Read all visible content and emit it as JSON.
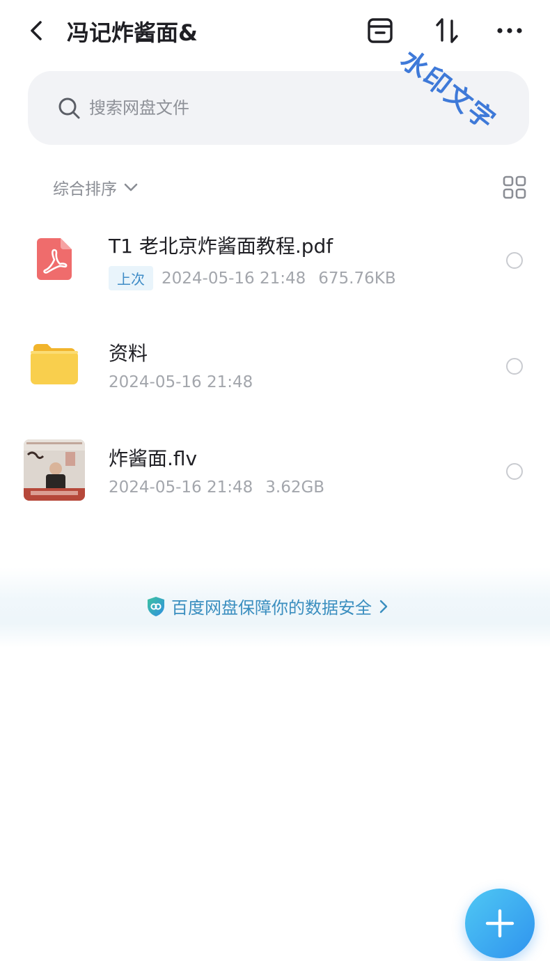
{
  "header": {
    "title": "冯记炸酱面&",
    "icons": [
      "back-icon",
      "archive-icon",
      "sort-icon",
      "more-icon"
    ]
  },
  "watermark": "水印文字",
  "search": {
    "placeholder": "搜索网盘文件"
  },
  "sort": {
    "label": "综合排序"
  },
  "files": [
    {
      "name": "T1 老北京炸酱面教程.pdf",
      "type": "pdf",
      "badge": "上次",
      "date": "2024-05-16  21:48",
      "size": "675.76KB"
    },
    {
      "name": "资料",
      "type": "folder",
      "date": "2024-05-16  21:48"
    },
    {
      "name": "炸酱面.flv",
      "type": "video",
      "date": "2024-05-16  21:48",
      "size": "3.62GB"
    }
  ],
  "security": {
    "text": "百度网盘保障你的数据安全"
  },
  "colors": {
    "accent": "#2f93ee",
    "link": "#3a8ebf",
    "pdf": "#ef6c6c",
    "folder": "#f7c948",
    "watermark": "#2f6fd6"
  }
}
